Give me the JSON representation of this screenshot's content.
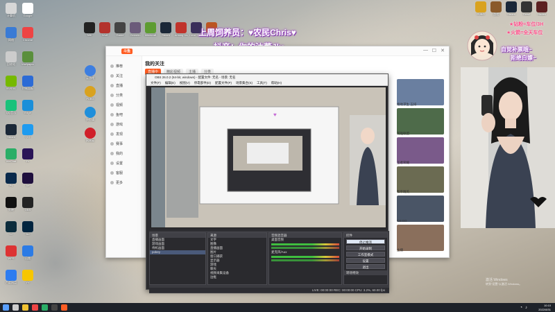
{
  "desktop": {
    "left_icons": [
      {
        "label": "计算机",
        "color": "#d7d7d7"
      },
      {
        "label": "Google",
        "color": "#fff"
      },
      {
        "label": "网络",
        "color": "#3a7bd5"
      },
      {
        "label": "Chrome",
        "color": "#e44"
      },
      {
        "label": "回收站",
        "color": "#ccc"
      },
      {
        "label": "Wallpaper",
        "color": "#5a8f3c"
      },
      {
        "label": "NVIDIA",
        "color": "#76b900"
      },
      {
        "label": "控制面板",
        "color": "#2c6bd6"
      },
      {
        "label": "QQ音乐",
        "color": "#19c27b"
      },
      {
        "label": "Edge",
        "color": "#1b8fd9"
      },
      {
        "label": "Steam",
        "color": "#1b2838"
      },
      {
        "label": "QQ",
        "color": "#1e9bf0"
      },
      {
        "label": "WeChat",
        "color": "#2aae67"
      },
      {
        "label": "Pr",
        "color": "#2a1457"
      },
      {
        "label": "Ps",
        "color": "#0a2a4b"
      },
      {
        "label": "Ae",
        "color": "#1f0f3d"
      },
      {
        "label": "剪映",
        "color": "#111"
      },
      {
        "label": "OBS",
        "color": "#232323"
      },
      {
        "label": "Lr",
        "color": "#0c2c3c"
      },
      {
        "label": "Au",
        "color": "#00243f"
      },
      {
        "label": "WPS",
        "color": "#d33"
      },
      {
        "label": "迅雷",
        "color": "#2c7be5"
      },
      {
        "label": "百度网盘",
        "color": "#2d7cf0"
      },
      {
        "label": "YY",
        "color": "#f7c600"
      }
    ],
    "mid_icons": [
      {
        "label": "云游戏",
        "color": "#3d7ee0"
      },
      {
        "label": "PUBG",
        "color": "#d9a21f"
      },
      {
        "label": "快剪辑",
        "color": "#1f8fdb"
      },
      {
        "label": "网易云",
        "color": "#d0202a"
      }
    ],
    "top_icons": [
      {
        "label": "NBI",
        "color": "#222"
      },
      {
        "label": "Wolf",
        "color": "#b3322c"
      },
      {
        "label": "Game",
        "color": "#444"
      },
      {
        "label": "Genshin",
        "color": "#6b5b7a"
      },
      {
        "label": "Minecraft",
        "color": "#5e9c32"
      },
      {
        "label": "Steam",
        "color": "#1b2838"
      },
      {
        "label": "Among Us",
        "color": "#c0332b"
      },
      {
        "label": "Dead Cells",
        "color": "#3a2f5a"
      },
      {
        "label": "Game",
        "color": "#bb5522"
      }
    ],
    "top_right_icons": [
      {
        "label": "PUBG",
        "color": "#d9a21f"
      },
      {
        "label": "游戏",
        "color": "#8a5a2a"
      },
      {
        "label": "Steam",
        "color": "#1b2838"
      },
      {
        "label": "Dead",
        "color": "#333"
      },
      {
        "label": "Hades",
        "color": "#5c2121"
      }
    ]
  },
  "overlay": {
    "line1": "上周饲养员：♥农民Chris♥",
    "line2": "抖音：你的沐董Jly",
    "right1": "自觉补票哦~",
    "right2": "拒绝白嫖~",
    "gift1": "★钻粉=车位/3H",
    "gift2": "★火箭=全天车位"
  },
  "main_window": {
    "logo": "斗鱼",
    "heading": "我的关注",
    "tabs": [
      "直播中",
      "精彩视频",
      "主播",
      "分类"
    ],
    "sidebar": [
      "推荐",
      "关注",
      "直播",
      "分类",
      "视频",
      "鱼吧",
      "游戏",
      "发现",
      "赛事",
      "我的",
      "设置",
      "客服",
      "更多"
    ],
    "right_cards": [
      {
        "label": "绝地求生 五排",
        "color": "#6a7fa0"
      },
      {
        "label": "英雄联盟",
        "color": "#4e6b4a"
      },
      {
        "label": "王者荣耀",
        "color": "#7a5a8a"
      },
      {
        "label": "和平精英",
        "color": "#6b6b52"
      },
      {
        "label": "CS:GO",
        "color": "#4a5566"
      },
      {
        "label": "主播",
        "color": "#8a6f5c"
      }
    ]
  },
  "obs": {
    "title": "OBS 26.0.2 (64-bit, windows) - 配置文件: 无名 - 场景: 无名",
    "menu": [
      "文件(F)",
      "编辑(E)",
      "视图(V)",
      "停靠部件(D)",
      "配置文件(P)",
      "场景集合(S)",
      "工具(T)",
      "帮助(H)"
    ],
    "scenes_head": "场景",
    "scenes": [
      "直播画面",
      "游戏画面",
      "待机画面",
      "pokey"
    ],
    "sources_head": "来源",
    "sources": [
      "文字",
      "图像",
      "直播画面",
      "图片",
      "窗口捕获",
      "显示器",
      "游戏",
      "聊天",
      "视频采集设备",
      "边框"
    ],
    "mixer_head": "音频混音器",
    "mixer": [
      "桌面音频",
      "麦克风/Aux"
    ],
    "controls_head": "控件",
    "controls": [
      "停止推流",
      "开始录制",
      "工作室模式",
      "设置",
      "退出"
    ],
    "transition_head": "转场特效",
    "status": "LIVE: 00:00:00  REC: 00:00:00  CPU: 3.2%, 60.00 fps"
  },
  "system": {
    "watermark_line1": "激活 Windows",
    "watermark_line2": "转到\"设置\"以激活 Windows。",
    "time": "10:10",
    "date": "2022/8/31",
    "taskbar_icons": [
      "start-icon",
      "search-icon",
      "file-explorer-icon",
      "chrome-icon",
      "wechat-icon",
      "obs-icon",
      "douyu-icon"
    ]
  }
}
